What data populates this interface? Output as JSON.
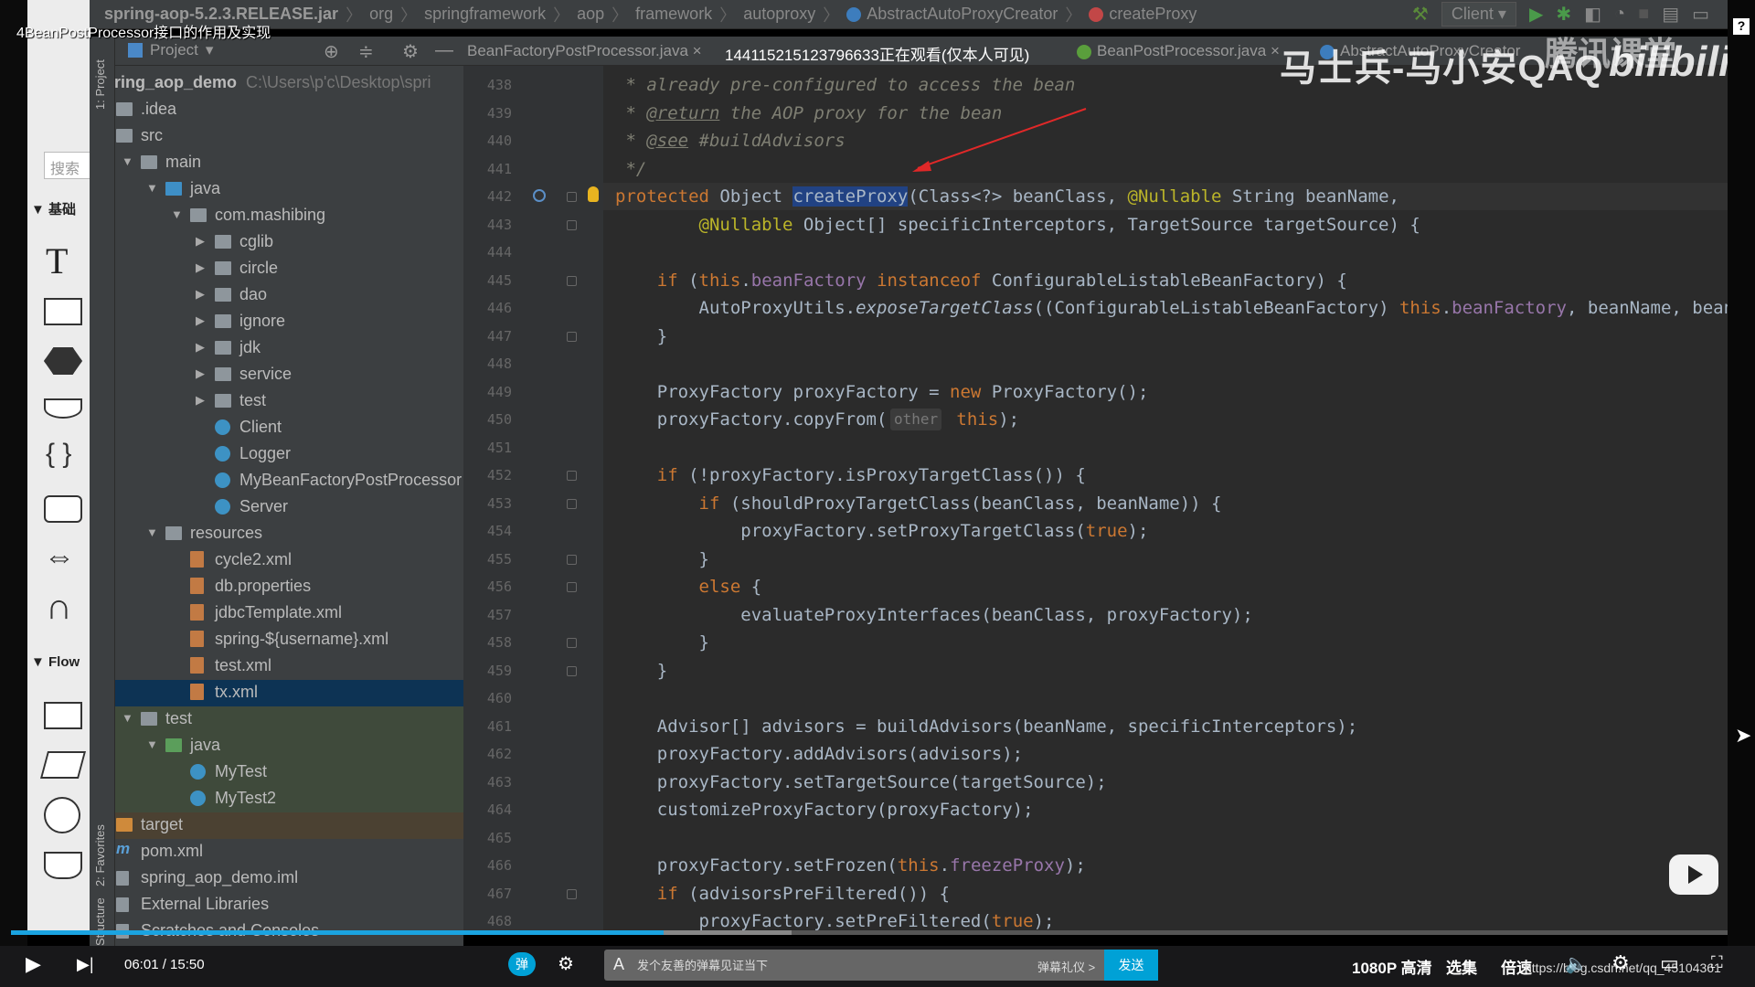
{
  "video_title": "4BeanPostProcessor接口的作用及实现",
  "breadcrumb": [
    "spring-aop-5.2.3.RELEASE.jar",
    "org",
    "springframework",
    "aop",
    "framework",
    "autoproxy",
    "AbstractAutoProxyCreator",
    "createProxy"
  ],
  "run_config": "Client",
  "palette": {
    "search_placeholder": "搜索",
    "section_basic": "▼ 基础",
    "section_flow": "▼ Flow",
    "text_tool": "T"
  },
  "side_strip": {
    "project": "1: Project",
    "favorites": "2: Favorites",
    "structure": "Structure"
  },
  "project_panel": {
    "title": "Project",
    "dropdown": "▾"
  },
  "tabs": [
    {
      "label": "BeanFactoryPostProcessor.java",
      "icon": "interface-icon"
    },
    {
      "label": "BeanPostProcessor.java",
      "icon": "interface-icon"
    },
    {
      "label": "AbstractAutoProxyCreator",
      "icon": "class-icon"
    }
  ],
  "viewers_notice": "144115215123796633正在观看(仅本人可见)",
  "watermark": {
    "uploader": "马士兵-马小安QAQ",
    "platform": "腾讯课堂",
    "site": "bilibili"
  },
  "tree": [
    {
      "label": "spring_aop_demo",
      "path": "C:\\Users\\p'c\\Desktop\\spri",
      "depth": 0,
      "icon": "module",
      "bold": true
    },
    {
      "label": ".idea",
      "depth": 0,
      "icon": "folder"
    },
    {
      "label": "src",
      "depth": 0,
      "icon": "folder"
    },
    {
      "label": "main",
      "depth": 1,
      "icon": "folder",
      "arrow": "open"
    },
    {
      "label": "java",
      "depth": 2,
      "icon": "folder-blue",
      "arrow": "open"
    },
    {
      "label": "com.mashibing",
      "depth": 3,
      "icon": "package",
      "arrow": "open"
    },
    {
      "label": "cglib",
      "depth": 4,
      "icon": "package",
      "arrow": "closed"
    },
    {
      "label": "circle",
      "depth": 4,
      "icon": "package",
      "arrow": "closed"
    },
    {
      "label": "dao",
      "depth": 4,
      "icon": "package",
      "arrow": "closed"
    },
    {
      "label": "ignore",
      "depth": 4,
      "icon": "package",
      "arrow": "closed"
    },
    {
      "label": "jdk",
      "depth": 4,
      "icon": "package",
      "arrow": "closed"
    },
    {
      "label": "service",
      "depth": 4,
      "icon": "package",
      "arrow": "closed"
    },
    {
      "label": "test",
      "depth": 4,
      "icon": "package",
      "arrow": "closed"
    },
    {
      "label": "Client",
      "depth": 4,
      "icon": "class"
    },
    {
      "label": "Logger",
      "depth": 4,
      "icon": "class"
    },
    {
      "label": "MyBeanFactoryPostProcessor",
      "depth": 4,
      "icon": "class"
    },
    {
      "label": "Server",
      "depth": 4,
      "icon": "class"
    },
    {
      "label": "resources",
      "depth": 2,
      "icon": "folder",
      "arrow": "open"
    },
    {
      "label": "cycle2.xml",
      "depth": 3,
      "icon": "xml"
    },
    {
      "label": "db.properties",
      "depth": 3,
      "icon": "xml"
    },
    {
      "label": "jdbcTemplate.xml",
      "depth": 3,
      "icon": "xml"
    },
    {
      "label": "spring-${username}.xml",
      "depth": 3,
      "icon": "xml"
    },
    {
      "label": "test.xml",
      "depth": 3,
      "icon": "xml"
    },
    {
      "label": "tx.xml",
      "depth": 3,
      "icon": "xml",
      "selected": true
    },
    {
      "label": "test",
      "depth": 1,
      "icon": "folder",
      "arrow": "open",
      "tint": "green"
    },
    {
      "label": "java",
      "depth": 2,
      "icon": "folder-green",
      "arrow": "open",
      "tint": "green"
    },
    {
      "label": "MyTest",
      "depth": 3,
      "icon": "class",
      "tint": "green"
    },
    {
      "label": "MyTest2",
      "depth": 3,
      "icon": "class",
      "tint": "green"
    },
    {
      "label": "target",
      "depth": 0,
      "icon": "folder-orange",
      "tint": "orange"
    },
    {
      "label": "pom.xml",
      "depth": 0,
      "icon": "maven"
    },
    {
      "label": "spring_aop_demo.iml",
      "depth": 0,
      "icon": "iml"
    },
    {
      "label": "External Libraries",
      "depth": 0,
      "icon": "library"
    },
    {
      "label": "Scratches and Consoles",
      "depth": 0,
      "icon": "scratch"
    }
  ],
  "code": {
    "current_line": 442,
    "selected_word": "createProxy",
    "lines": [
      {
        "n": 438,
        "t": " * already pre-configured to access the bean"
      },
      {
        "n": 439,
        "t": " * @return the AOP proxy for the bean"
      },
      {
        "n": 440,
        "t": " * @see #buildAdvisors"
      },
      {
        "n": 441,
        "t": " */"
      },
      {
        "n": 442,
        "t": "protected Object createProxy(Class<?> beanClass, @Nullable String beanName,"
      },
      {
        "n": 443,
        "t": "        @Nullable Object[] specificInterceptors, TargetSource targetSource) {"
      },
      {
        "n": 444,
        "t": ""
      },
      {
        "n": 445,
        "t": "    if (this.beanFactory instanceof ConfigurableListableBeanFactory) {"
      },
      {
        "n": 446,
        "t": "        AutoProxyUtils.exposeTargetClass((ConfigurableListableBeanFactory) this.beanFactory, beanName, beanClass);"
      },
      {
        "n": 447,
        "t": "    }"
      },
      {
        "n": 448,
        "t": ""
      },
      {
        "n": 449,
        "t": "    ProxyFactory proxyFactory = new ProxyFactory();"
      },
      {
        "n": 450,
        "t": "    proxyFactory.copyFrom(this);",
        "hint": "other",
        "hint_after": "copyFrom("
      },
      {
        "n": 451,
        "t": ""
      },
      {
        "n": 452,
        "t": "    if (!proxyFactory.isProxyTargetClass()) {"
      },
      {
        "n": 453,
        "t": "        if (shouldProxyTargetClass(beanClass, beanName)) {"
      },
      {
        "n": 454,
        "t": "            proxyFactory.setProxyTargetClass(true);"
      },
      {
        "n": 455,
        "t": "        }"
      },
      {
        "n": 456,
        "t": "        else {"
      },
      {
        "n": 457,
        "t": "            evaluateProxyInterfaces(beanClass, proxyFactory);"
      },
      {
        "n": 458,
        "t": "        }"
      },
      {
        "n": 459,
        "t": "    }"
      },
      {
        "n": 460,
        "t": ""
      },
      {
        "n": 461,
        "t": "    Advisor[] advisors = buildAdvisors(beanName, specificInterceptors);"
      },
      {
        "n": 462,
        "t": "    proxyFactory.addAdvisors(advisors);"
      },
      {
        "n": 463,
        "t": "    proxyFactory.setTargetSource(targetSource);"
      },
      {
        "n": 464,
        "t": "    customizeProxyFactory(proxyFactory);"
      },
      {
        "n": 465,
        "t": ""
      },
      {
        "n": 466,
        "t": "    proxyFactory.setFrozen(this.freezeProxy);"
      },
      {
        "n": 467,
        "t": "    if (advisorsPreFiltered()) {"
      },
      {
        "n": 468,
        "t": "        proxyFactory.setPreFiltered(true);"
      }
    ]
  },
  "player": {
    "current_time": "06:01",
    "duration": "15:50",
    "time_display": "06:01 / 15:50",
    "progress": 0.38,
    "buffered": 0.455,
    "danmaku_placeholder": "发个友善的弹幕见证当下",
    "danmaku_etiquette": "弹幕礼仪 >",
    "send_label": "发送",
    "quality": "1080P 高清",
    "episodes": "选集",
    "speed": "倍速",
    "url_watermark": "https://blog.csdn.net/qq_45104361"
  },
  "colors": {
    "keyword": "#cc7832",
    "annotation": "#bbb529",
    "field": "#9876aa",
    "selection": "#214283",
    "accent": "#00a1d6",
    "progress": "#1aa3e0"
  }
}
